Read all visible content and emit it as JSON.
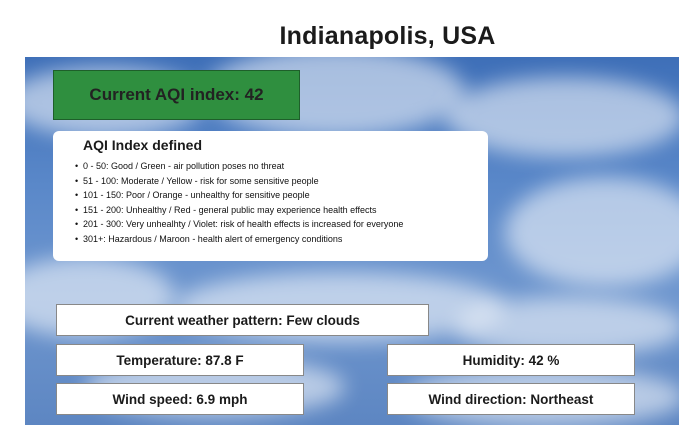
{
  "header": {
    "city": "Indianapolis, USA"
  },
  "aqi": {
    "current_label": "Current AQI index: 42",
    "current_color": "#2f8f3f"
  },
  "aqi_defined": {
    "title": "AQI Index defined",
    "items": [
      "0 - 50: Good / Green - air pollution poses no threat",
      "51 - 100: Moderate / Yellow - risk for some sensitive people",
      "101 - 150: Poor / Orange - unhealthy for sensitive people",
      "151 - 200: Unhealthy / Red - general public may experience health effects",
      "201 - 300: Very unhealhty / Violet: risk of health effects is increased for everyone",
      "301+: Hazardous / Maroon - health alert of emergency conditions"
    ]
  },
  "weather": {
    "pattern": "Current weather pattern: Few clouds",
    "temperature": "Temperature: 87.8 F",
    "humidity": "Humidity: 42 %",
    "wind_speed": "Wind speed: 6.9 mph",
    "wind_direction": "Wind direction: Northeast"
  }
}
